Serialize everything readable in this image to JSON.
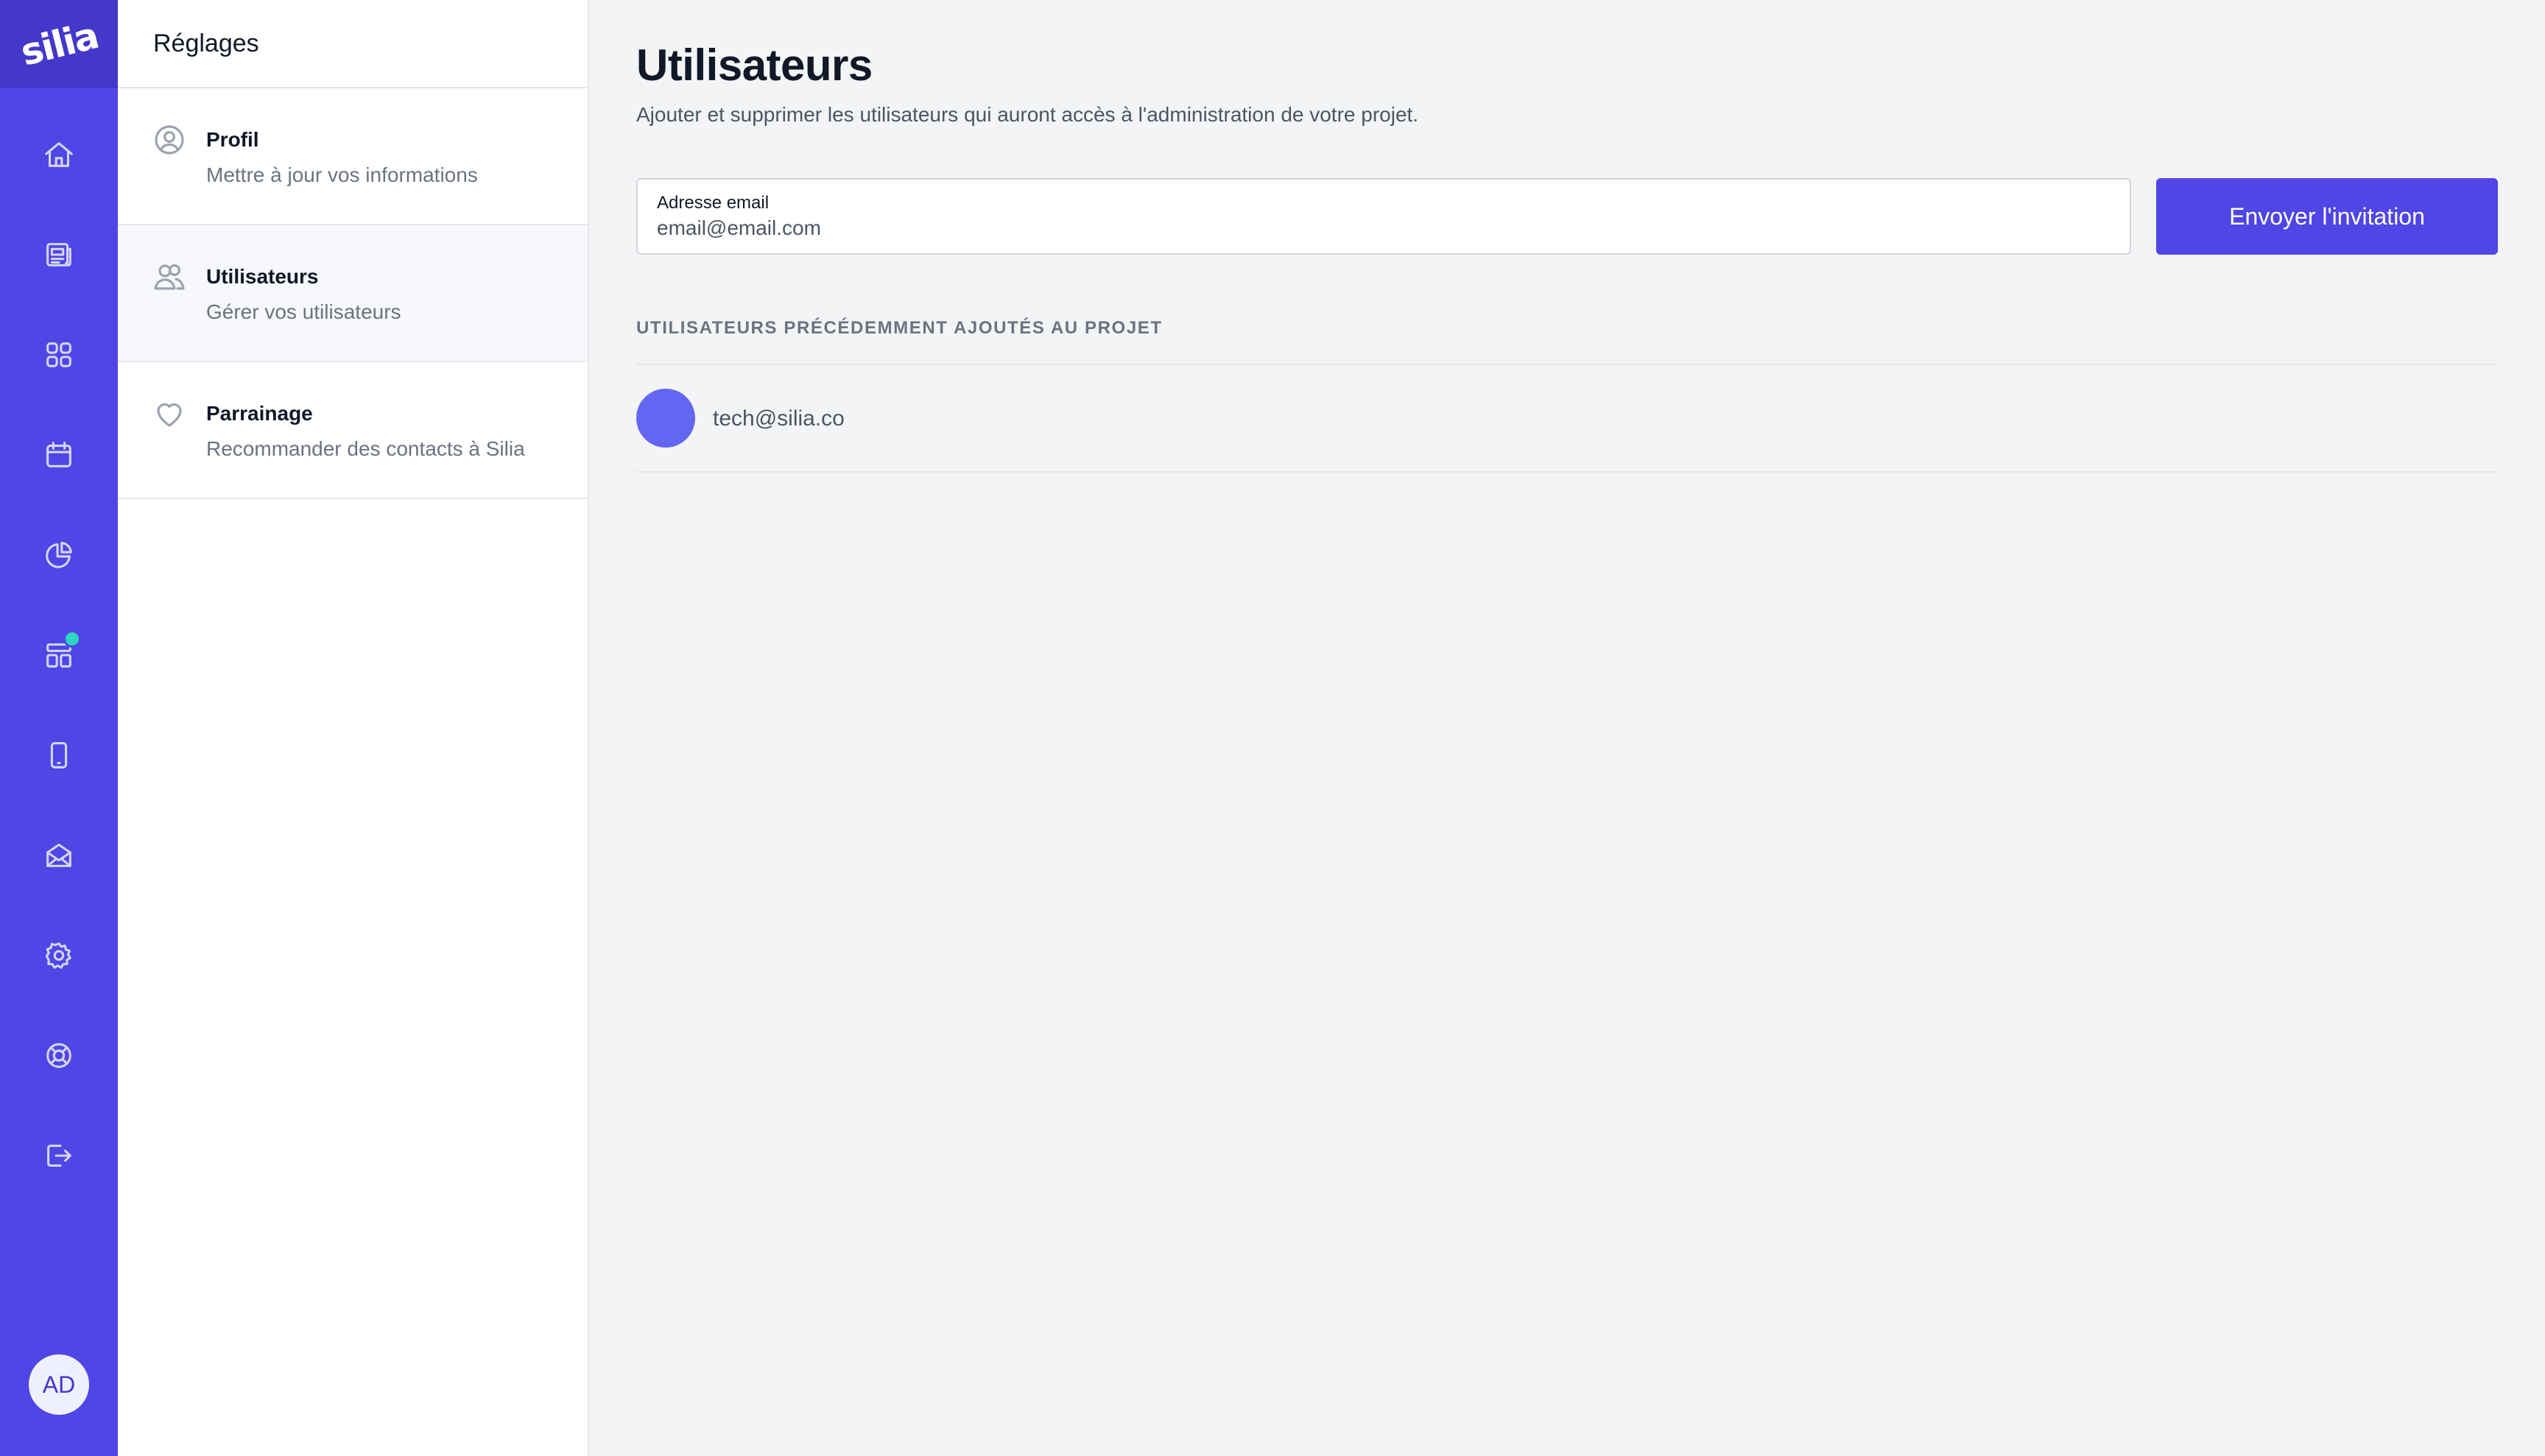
{
  "brand": {
    "logo_text": "silia",
    "primary_color": "#4f46e5",
    "logo_bg_color": "#4338ca",
    "notification_color": "#2dd4bf"
  },
  "rail": {
    "items": [
      {
        "icon": "home-icon"
      },
      {
        "icon": "newspaper-icon"
      },
      {
        "icon": "grid-icon"
      },
      {
        "icon": "calendar-icon"
      },
      {
        "icon": "pie-chart-icon"
      },
      {
        "icon": "layout-icon",
        "notification": true
      },
      {
        "icon": "mobile-icon"
      },
      {
        "icon": "mail-open-icon"
      },
      {
        "icon": "gear-icon"
      },
      {
        "icon": "lifebuoy-icon"
      },
      {
        "icon": "logout-icon"
      }
    ],
    "avatar_initials": "AD"
  },
  "settings": {
    "title": "Réglages",
    "menu": [
      {
        "icon": "user-circle-icon",
        "title": "Profil",
        "subtitle": "Mettre à jour vos informations",
        "active": false
      },
      {
        "icon": "users-icon",
        "title": "Utilisateurs",
        "subtitle": "Gérer vos utilisateurs",
        "active": true
      },
      {
        "icon": "heart-icon",
        "title": "Parrainage",
        "subtitle": "Recommander des contacts à Silia",
        "active": false
      }
    ]
  },
  "main": {
    "title": "Utilisateurs",
    "description": "Ajouter et supprimer les utilisateurs qui auront accès à l'administration de votre projet.",
    "email_field": {
      "label": "Adresse email",
      "placeholder": "email@email.com",
      "value": ""
    },
    "invite_button": "Envoyer l'invitation",
    "users_heading": "UTILISATEURS PRÉCÉDEMMENT AJOUTÉS AU PROJET",
    "users": [
      {
        "email": "tech@silia.co",
        "avatar_color": "#6366f1"
      }
    ]
  }
}
